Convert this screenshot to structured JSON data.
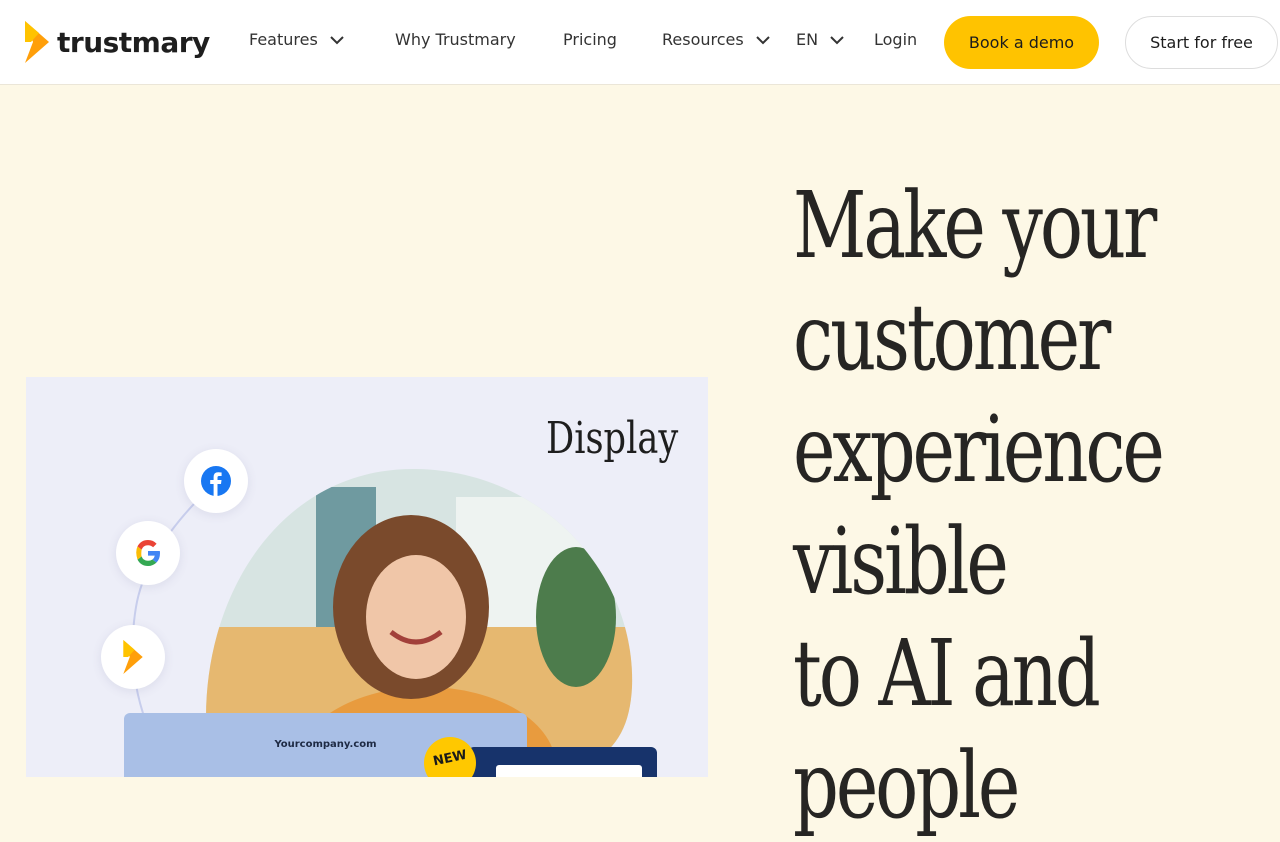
{
  "brand": {
    "name": "trustmary",
    "accent": "#ffc300",
    "logo_orange": "#ff9f0a"
  },
  "nav": {
    "features": "Features",
    "why": "Why Trustmary",
    "pricing": "Pricing",
    "resources": "Resources",
    "language": "EN",
    "login": "Login",
    "book_demo": "Book a demo",
    "start_free": "Start for free"
  },
  "hero": {
    "headline_lines": [
      "Make your",
      "customer",
      "experience",
      "visible",
      "to AI and",
      "people"
    ]
  },
  "illustration": {
    "label": "Display",
    "sources": [
      "facebook-icon",
      "google-icon",
      "trustmary-icon"
    ],
    "screen_url": "Yourcompany.com",
    "badge": "NEW"
  }
}
